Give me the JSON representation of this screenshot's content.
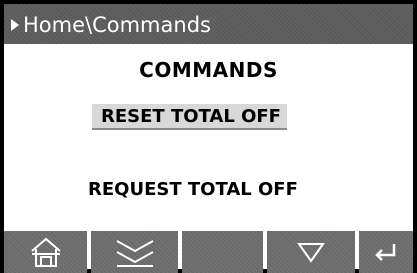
{
  "window": {
    "breadcrumb": "Home\\Commands",
    "breadcrumb_icon": "right-triangle-icon"
  },
  "main": {
    "heading": "COMMANDS",
    "items": [
      {
        "label": "RESET TOTAL OFF",
        "selected": true
      },
      {
        "label": "REQUEST TOTAL OFF",
        "selected": false
      }
    ]
  },
  "softkeys": [
    {
      "icon": "home-icon"
    },
    {
      "icon": "double-chevron-down-icon"
    },
    {
      "icon": ""
    },
    {
      "icon": "down-triangle-icon"
    },
    {
      "icon": "enter-icon"
    }
  ],
  "colors": {
    "titlebar_bg": "#5a5a5a",
    "softkey_bg": "#6a6a6a",
    "selected_bg": "#d8d8d8",
    "border": "#000000"
  }
}
